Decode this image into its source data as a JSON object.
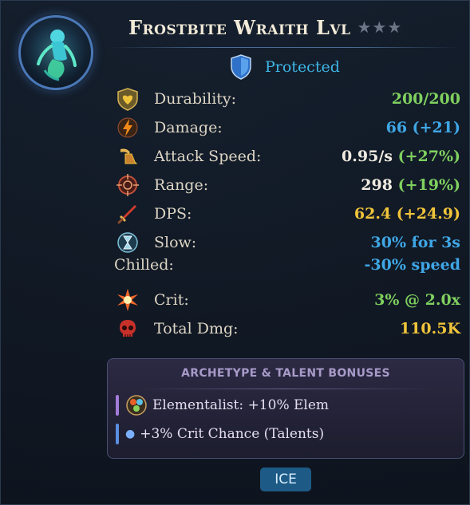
{
  "unit": {
    "name": "Frostbite Wraith Lvl",
    "stars": "★★★",
    "status": "Protected"
  },
  "stats": [
    {
      "label": "Durability:",
      "value": "200/200",
      "icon": "heart-shield-icon"
    },
    {
      "label": "Damage:",
      "value": "66 (+21)",
      "icon": "lightning-icon"
    },
    {
      "label": "Attack Speed:",
      "value_main": "0.95/s",
      "value_bonus": "(+27%)",
      "icon": "winged-boot-icon"
    },
    {
      "label": "Range:",
      "value_main": "298",
      "value_bonus": "(+19%)",
      "icon": "crosshair-icon"
    },
    {
      "label": "DPS:",
      "value": "62.4 (+24.9)",
      "icon": "sword-icon"
    },
    {
      "label": "Slow:",
      "value": "30% for 3s",
      "icon": "hourglass-icon"
    },
    {
      "label": "Chilled:",
      "value": "-30% speed"
    },
    {
      "label": "Crit:",
      "value": "3% @ 2.0x",
      "icon": "burst-icon"
    },
    {
      "label": "Total Dmg:",
      "value": "110.5K",
      "icon": "skull-icon"
    }
  ],
  "bonuses": {
    "title": "ARCHETYPE & TALENT BONUSES",
    "items": [
      {
        "text": "Elementalist: +10% Elem",
        "icon": "elements-orb-icon",
        "bar_color": "#a27cd8"
      },
      {
        "text": "+3% Crit Chance (Talents)",
        "bar_color": "#5b8fe0"
      }
    ]
  },
  "element_tag": "ICE",
  "colors": {
    "green": "#7fd05f",
    "blue": "#3fa7e6",
    "yellow": "#f0c43a",
    "status": "#3fb6e6"
  }
}
